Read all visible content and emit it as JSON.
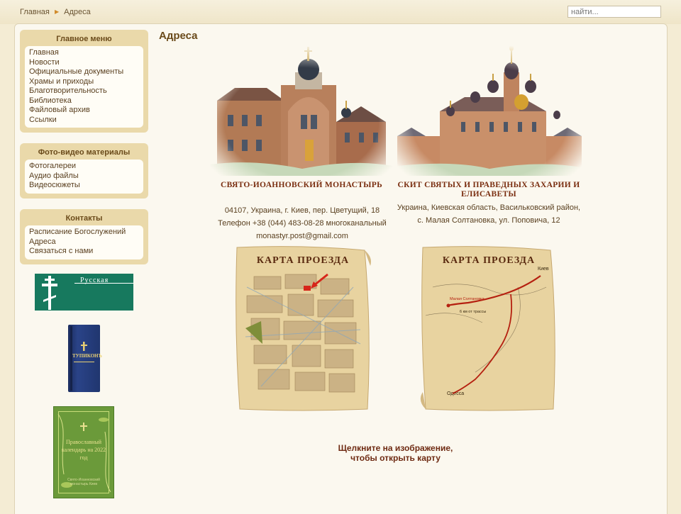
{
  "breadcrumb": {
    "home": "Главная",
    "current": "Адреса"
  },
  "search": {
    "placeholder": "найти..."
  },
  "menus": {
    "main": {
      "title": "Главное меню",
      "items": [
        "Главная",
        "Новости",
        "Официальные документы",
        "Храмы и приходы",
        "Благотворительность",
        "Библиотека",
        "Файловый архив",
        "Ссылки"
      ]
    },
    "media": {
      "title": "Фото-видео материалы",
      "items": [
        "Фотогалереи",
        "Аудио файлы",
        "Видеосюжеты"
      ]
    },
    "contacts": {
      "title": "Контакты",
      "items": [
        "Расписание Богослужений",
        "Адреса",
        "Связаться с нами"
      ]
    }
  },
  "banners": {
    "russian": "Русская",
    "blue_book": "ТУПИКОНЪ",
    "green_book_title": "Православный календарь на 2022 год",
    "green_book_sub": "Свято-Иоанновский монастырь Киев"
  },
  "content": {
    "title": "Адреса",
    "locations": [
      {
        "name": "СВЯТО-ИОАННОВСКИЙ МОНАСТЫРЬ",
        "address1": "04107, Украина, г. Киев, пер. Цветущий, 18",
        "address2": "Телефон +38 (044) 483-08-28 многоканальный",
        "address3": "monastyr.post@gmail.com"
      },
      {
        "name": "СКИТ СВЯТЫХ И ПРАВЕДНЫХ ЗАХАРИИ И ЕЛИСАВЕТЫ",
        "address1": "Украина, Киевская область, Васильковский район,",
        "address2": "с. Малая Солтановка, ул. Поповича, 12"
      }
    ],
    "map_title": "КАРТА ПРОЕЗДА",
    "map2_labels": {
      "kiev": "Киев",
      "odessa": "Одесса",
      "village": "Малая Солтановка",
      "distance": "6 км от трассы"
    },
    "hint_line1": "Щелкните на изображение,",
    "hint_line2": "чтобы открыть карту"
  },
  "colors": {
    "background": "#f4ecd4",
    "module": "#ead9aa",
    "heading": "#7a2e10",
    "banner_green": "#17795e"
  }
}
